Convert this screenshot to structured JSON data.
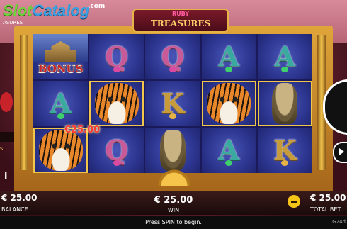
{
  "logo": {
    "prefix": "Slot",
    "word": "Catalog",
    "suffix": ".com"
  },
  "game_subtitle": "ASURES",
  "title": {
    "top": "RUBY",
    "main": "TREASURES"
  },
  "reels": [
    [
      {
        "type": "bonus",
        "label": "BONUS"
      },
      {
        "type": "letter",
        "symbol": "A",
        "color": "a"
      },
      {
        "type": "tiger"
      }
    ],
    [
      {
        "type": "letter",
        "symbol": "Q",
        "color": "q"
      },
      {
        "type": "tiger"
      },
      {
        "type": "letter",
        "symbol": "Q",
        "color": "q"
      }
    ],
    [
      {
        "type": "letter",
        "symbol": "Q",
        "color": "q"
      },
      {
        "type": "letter",
        "symbol": "K",
        "color": "k"
      },
      {
        "type": "cobra"
      }
    ],
    [
      {
        "type": "letter",
        "symbol": "A",
        "color": "a"
      },
      {
        "type": "tiger"
      },
      {
        "type": "letter",
        "symbol": "A",
        "color": "a"
      }
    ],
    [
      {
        "type": "letter",
        "symbol": "A",
        "color": "a"
      },
      {
        "type": "cobra"
      },
      {
        "type": "letter",
        "symbol": "K",
        "color": "k"
      }
    ]
  ],
  "win_amount_overlay": "€25.00",
  "balance": {
    "value": "€ 25.00",
    "label": "BALANCE"
  },
  "win": {
    "value": "€ 25.00",
    "label": "WIN"
  },
  "total_bet": {
    "value": "€ 25.00",
    "label": "TOTAL BET"
  },
  "status_text": "Press SPIN to begin.",
  "corner_tag": "G24d",
  "left_partial": "s",
  "info_glyph": "i",
  "colors": {
    "accent_gold": "#f2c54b",
    "reel_bg": "#2d3690",
    "bonus_red": "#c8232a"
  }
}
